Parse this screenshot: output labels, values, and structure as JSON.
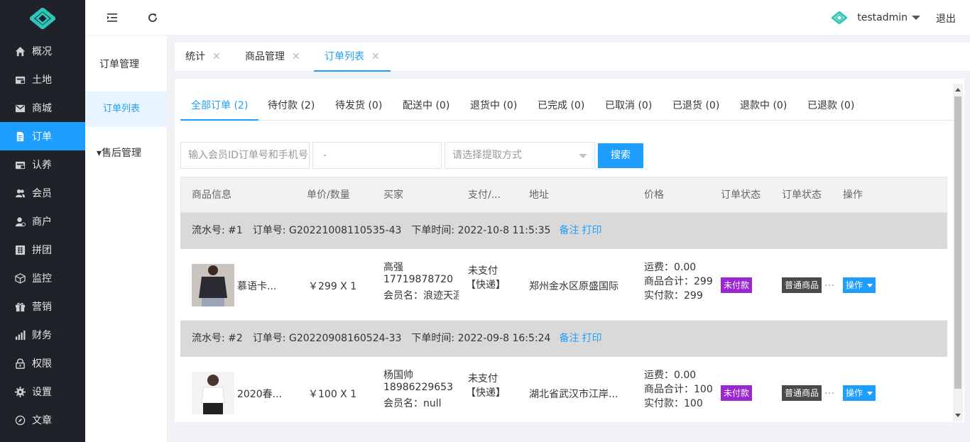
{
  "sidebar": {
    "items": [
      {
        "label": "概况",
        "icon": "home-icon"
      },
      {
        "label": "土地",
        "icon": "land-icon"
      },
      {
        "label": "商城",
        "icon": "mail-icon"
      },
      {
        "label": "订单",
        "icon": "order-icon"
      },
      {
        "label": "认养",
        "icon": "adopt-icon"
      },
      {
        "label": "会员",
        "icon": "members-icon"
      },
      {
        "label": "商户",
        "icon": "merchant-icon"
      },
      {
        "label": "拼团",
        "icon": "group-buy-icon"
      },
      {
        "label": "监控",
        "icon": "cube-icon"
      },
      {
        "label": "营销",
        "icon": "gift-icon"
      },
      {
        "label": "财务",
        "icon": "chart-icon"
      },
      {
        "label": "权限",
        "icon": "lock-icon"
      },
      {
        "label": "设置",
        "icon": "gear-icon"
      },
      {
        "label": "文章",
        "icon": "compass-icon"
      }
    ],
    "active_index": 3
  },
  "topbar": {
    "username": "testadmin",
    "logout": "退出"
  },
  "submenu": {
    "title": "订单管理",
    "active_item": "订单列表",
    "group": "▾售后管理"
  },
  "tabs": [
    {
      "label": "统计"
    },
    {
      "label": "商品管理"
    },
    {
      "label": "订单列表"
    }
  ],
  "order_tabs": [
    "全部订单 (2)",
    "待付款 (2)",
    "待发货 (0)",
    "配送中 (0)",
    "退货中 (0)",
    "已完成 (0)",
    "已取消 (0)",
    "已退货 (0)",
    "退款中 (0)",
    "已退款 (0)"
  ],
  "filters": {
    "search_placeholder": "输入会员ID订单号和手机号",
    "date_placeholder": "-",
    "pickup_placeholder": "请选择提取方式",
    "search_button": "搜索"
  },
  "table": {
    "headers": [
      "商品信息",
      "单价/数量",
      "买家",
      "支付/...",
      "地址",
      "价格",
      "订单状态",
      "订单状态",
      "操作"
    ],
    "orders": [
      {
        "serial": "流水号: #1",
        "order_no": "订单号: G20221008110535-43",
        "time": "下单时间: 2022-10-8 11:5:35",
        "note": "备注",
        "print": "打印",
        "product": "慕语卡...",
        "price_qty": "￥299 X 1",
        "buyer_name": "高强",
        "buyer_phone": "17719878720",
        "buyer_member": "会员名：浪迹天涯",
        "pay_status": "未支付",
        "delivery": "【快递】",
        "address": "郑州金水区原盛国际",
        "freight": "运费：0.00",
        "goods_total": "商品合计：299",
        "paid": "实付款：299",
        "status": "未付款",
        "type": "普通商品",
        "op": "操作",
        "thumb_color": "#2a2a32"
      },
      {
        "serial": "流水号: #2",
        "order_no": "订单号: G20220908160524-33",
        "time": "下单时间: 2022-09-8 16:5:24",
        "note": "备注",
        "print": "打印",
        "product": "2020春...",
        "price_qty": "￥100 X 1",
        "buyer_name": "杨国帅",
        "buyer_phone": "18986229653",
        "buyer_member": "会员名：null",
        "pay_status": "未支付",
        "delivery": "【快递】",
        "address": "湖北省武汉市江岸...",
        "freight": "运费：0.00",
        "goods_total": "商品合计：100",
        "paid": "实付款：100",
        "status": "未付款",
        "type": "普通商品",
        "op": "操作",
        "thumb_color": "#efeff0"
      }
    ]
  }
}
